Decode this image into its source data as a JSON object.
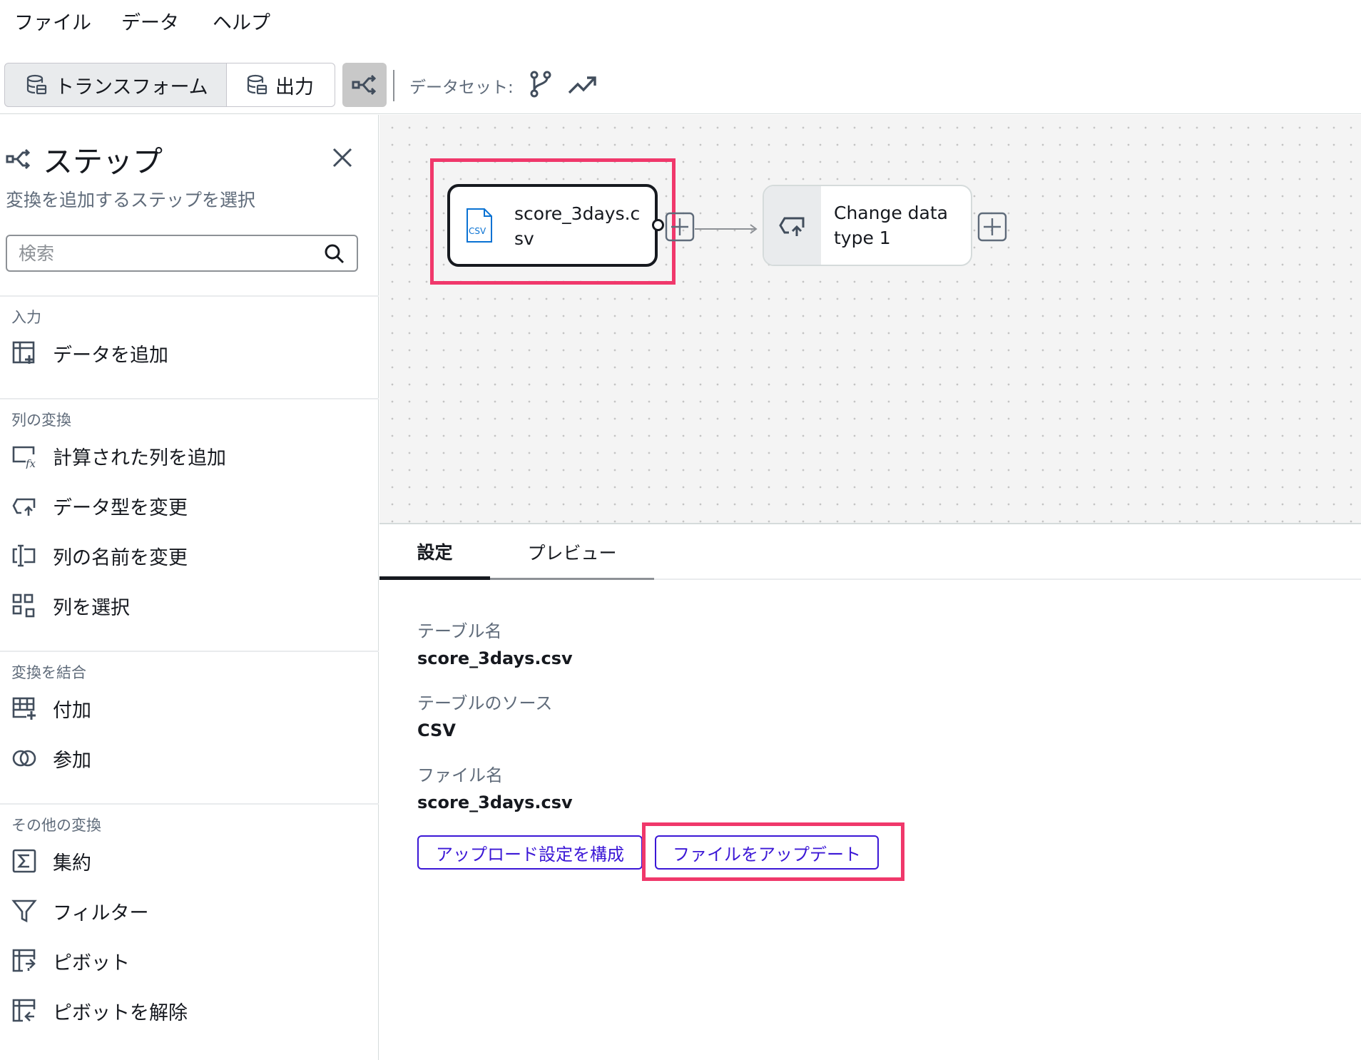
{
  "menu": {
    "file": "ファイル",
    "data": "データ",
    "help": "ヘルプ"
  },
  "toolbar": {
    "transform_label": "トランスフォーム",
    "output_label": "出力",
    "dataset_label": "データセット:"
  },
  "steps_panel": {
    "title": "ステップ",
    "subtitle": "変換を追加するステップを選択",
    "search_placeholder": "検索",
    "sections": {
      "input": {
        "heading": "入力",
        "items": [
          "データを追加"
        ]
      },
      "column": {
        "heading": "列の変換",
        "items": [
          "計算された列を追加",
          "データ型を変更",
          "列の名前を変更",
          "列を選択"
        ]
      },
      "combine": {
        "heading": "変換を結合",
        "items": [
          "付加",
          "参加"
        ]
      },
      "other": {
        "heading": "その他の変換",
        "items": [
          "集約",
          "フィルター",
          "ピボット",
          "ピボットを解除"
        ]
      }
    }
  },
  "flow": {
    "nodes": [
      {
        "label": "score_3days.csv",
        "icon": "csv-file-icon",
        "selected": true
      },
      {
        "label": "Change data type 1",
        "icon": "change-type-icon",
        "selected": false
      }
    ]
  },
  "detail": {
    "tabs": {
      "settings": "設定",
      "preview": "プレビュー"
    },
    "table_name_label": "テーブル名",
    "table_name_value": "score_3days.csv",
    "table_source_label": "テーブルのソース",
    "table_source_value": "CSV",
    "file_name_label": "ファイル名",
    "file_name_value": "score_3days.csv",
    "configure_upload_button": "アップロード設定を構成",
    "update_file_button": "ファイルをアップデート"
  },
  "colors": {
    "highlight": "#f0386b",
    "link": "#3b17d6",
    "csv_icon": "#0972d3"
  }
}
